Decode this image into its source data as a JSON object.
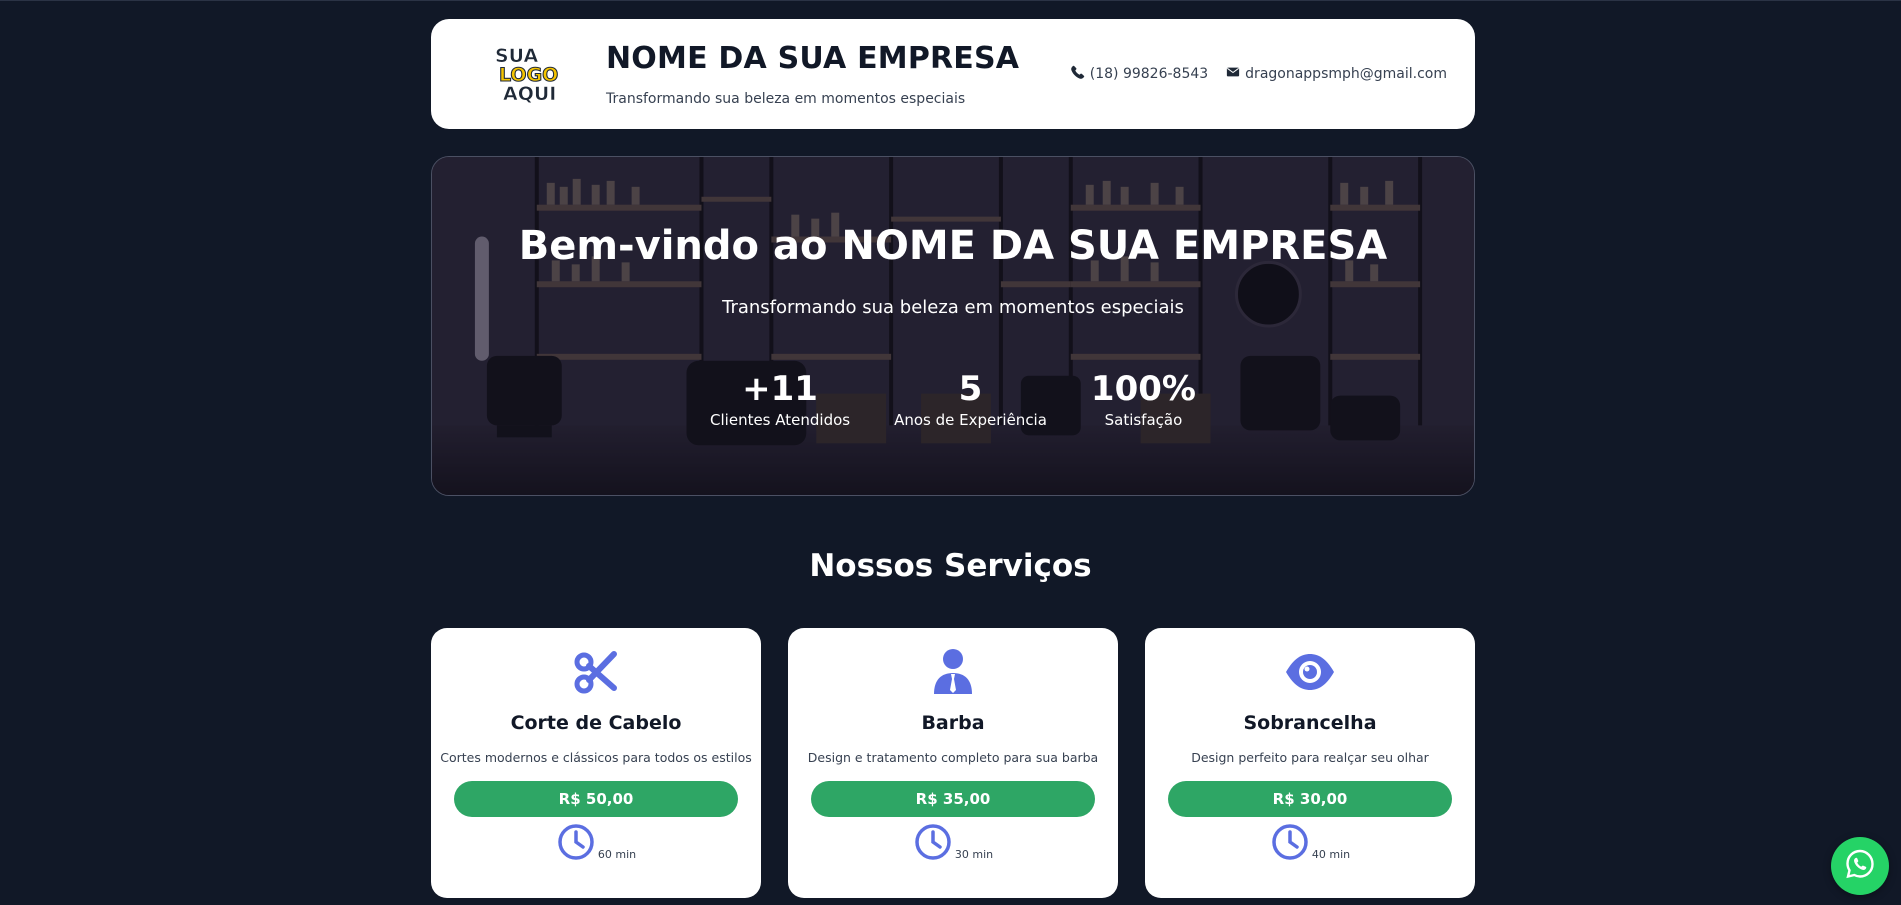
{
  "header": {
    "logo_text": [
      "SUA",
      "LOGO",
      "AQUI"
    ],
    "company_name": "NOME DA SUA EMPRESA",
    "tagline": "Transformando sua beleza em momentos especiais",
    "phone": "(18) 99826-8543",
    "email": "dragonappsmph@gmail.com"
  },
  "hero": {
    "title": "Bem-vindo ao NOME DA SUA EMPRESA",
    "subtitle": "Transformando sua beleza em momentos especiais",
    "stats": [
      {
        "value": "+11",
        "label": "Clientes Atendidos"
      },
      {
        "value": "5",
        "label": "Anos de Experiência"
      },
      {
        "value": "100%",
        "label": "Satisfação"
      }
    ]
  },
  "services": {
    "title": "Nossos Serviços",
    "items": [
      {
        "icon": "scissors-icon",
        "name": "Corte de Cabelo",
        "description": "Cortes modernos e clássicos para todos os estilos",
        "price": "R$ 50,00",
        "duration": "60 min"
      },
      {
        "icon": "person-icon",
        "name": "Barba",
        "description": "Design e tratamento completo para sua barba",
        "price": "R$ 35,00",
        "duration": "30 min"
      },
      {
        "icon": "eye-icon",
        "name": "Sobrancelha",
        "description": "Design perfeito para realçar seu olhar",
        "price": "R$ 30,00",
        "duration": "40 min"
      }
    ]
  },
  "floating": {
    "icon": "whatsapp-icon"
  },
  "colors": {
    "background": "#111827",
    "accent_icon": "#5b6ee1",
    "price_button": "#2ea665",
    "whatsapp": "#25d366"
  }
}
